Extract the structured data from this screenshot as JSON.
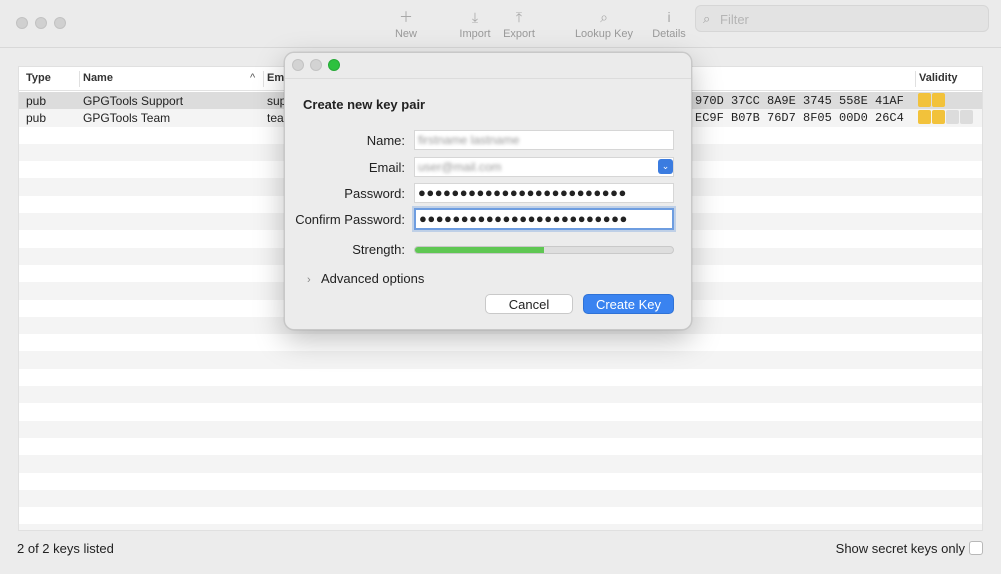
{
  "toolbar": {
    "items": [
      {
        "label": "New",
        "icon": "plus-icon"
      },
      {
        "label": "Import",
        "icon": "import-icon"
      },
      {
        "label": "Export",
        "icon": "export-icon"
      },
      {
        "label": "Lookup Key",
        "icon": "magnifier-icon"
      },
      {
        "label": "Details",
        "icon": "info-icon"
      }
    ],
    "filter_placeholder": "Filter"
  },
  "table": {
    "columns": [
      "Type",
      "Name",
      "Ema",
      "Validity"
    ],
    "rows": [
      {
        "type": "pub",
        "name": "GPGTools Support",
        "email": "sup",
        "fingerprint": "970D  37CC 8A9E 3745 558E 41AF",
        "validity": 2
      },
      {
        "type": "pub",
        "name": "GPGTools Team",
        "email": "tea",
        "fingerprint": "EC9F  B07B 76D7 8F05 00D0 26C4",
        "validity": 2
      }
    ]
  },
  "status": {
    "count_text": "2 of 2 keys listed",
    "secret_label": "Show secret keys only"
  },
  "dialog": {
    "heading": "Create new key pair",
    "name_label": "Name:",
    "name_value": "firstname lastname",
    "email_label": "Email:",
    "email_value": "user@mail.com",
    "password_label": "Password:",
    "password_value": "●●●●●●●●●●●●●●●●●●●●●●●●●",
    "confirm_label": "Confirm Password:",
    "confirm_value": "●●●●●●●●●●●●●●●●●●●●●●●●●",
    "strength_label": "Strength:",
    "strength": 0.5,
    "advanced_label": "Advanced options",
    "cancel_label": "Cancel",
    "create_label": "Create Key"
  },
  "colors": {
    "accent": "#3a83f0",
    "strength": "#5fc753",
    "validity_on": "#f2c23b"
  }
}
